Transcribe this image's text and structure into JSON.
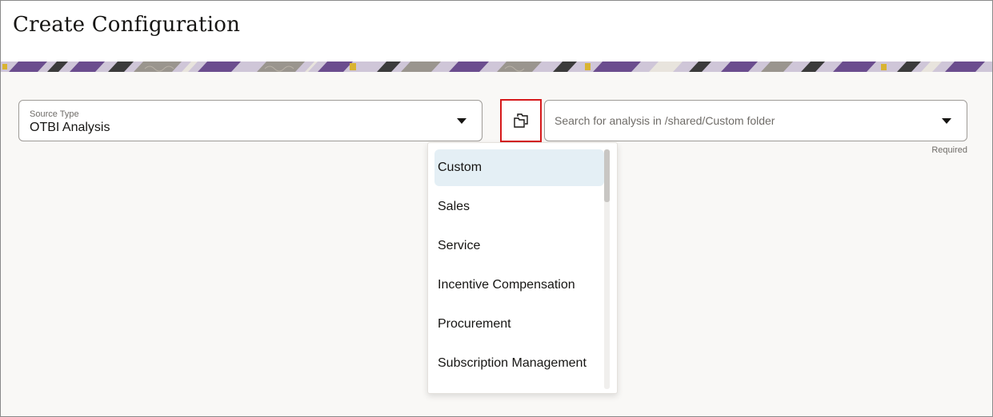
{
  "page": {
    "title": "Create Configuration"
  },
  "form": {
    "source_type": {
      "label": "Source Type",
      "value": "OTBI Analysis"
    },
    "folder_button": {
      "icon": "folder-browse-icon"
    },
    "analysis_search": {
      "placeholder": "Search for analysis in /shared/Custom folder",
      "value": "",
      "required_text": "Required"
    }
  },
  "dropdown": {
    "items": [
      {
        "label": "Custom",
        "selected": true
      },
      {
        "label": "Sales",
        "selected": false
      },
      {
        "label": "Service",
        "selected": false
      },
      {
        "label": "Incentive Compensation",
        "selected": false
      },
      {
        "label": "Procurement",
        "selected": false
      },
      {
        "label": "Subscription Management",
        "selected": false
      }
    ]
  },
  "colors": {
    "highlight_border": "#d6191b",
    "selected_item_bg": "#e4eff5",
    "banner_purple": "#6b4d8e",
    "page_bg": "#f9f8f6"
  }
}
